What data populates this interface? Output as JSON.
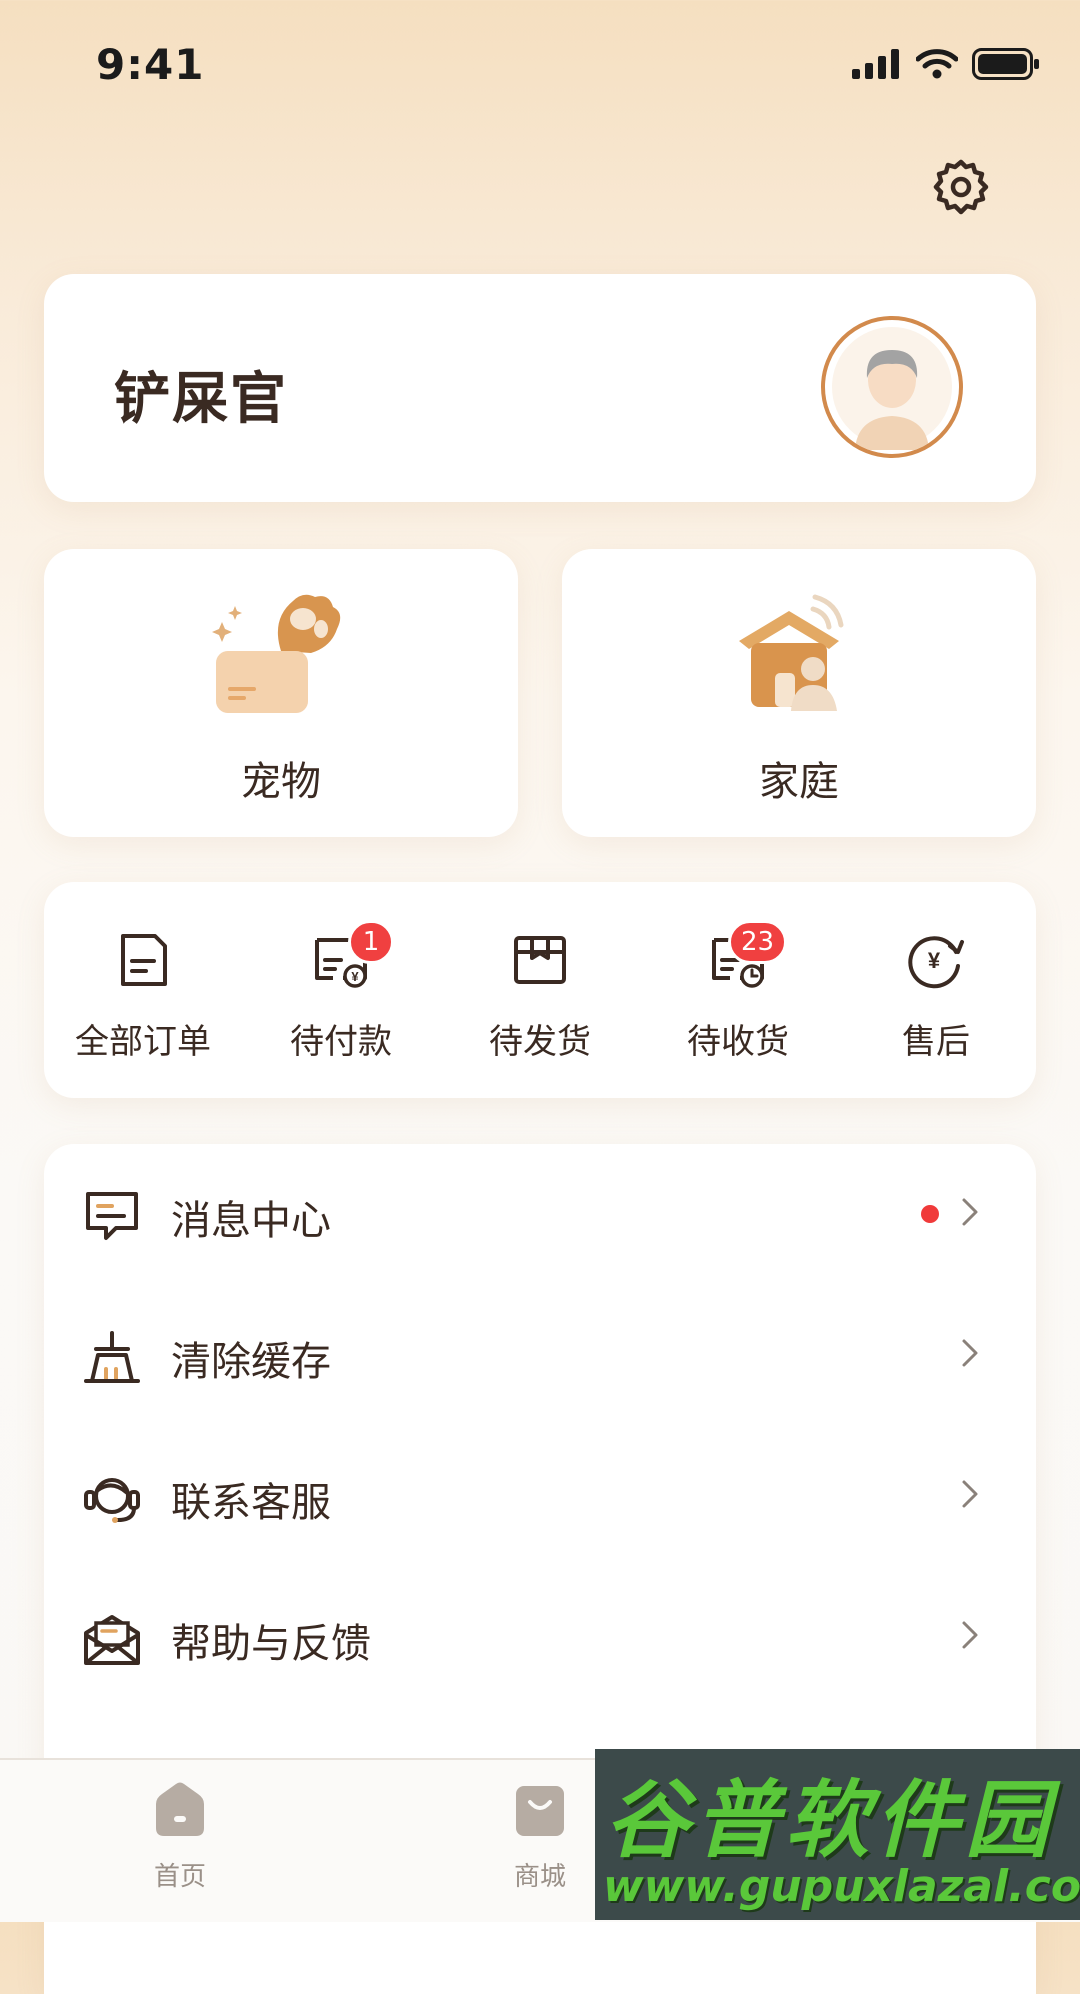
{
  "status_bar": {
    "time": "9:41"
  },
  "profile": {
    "name": "铲屎官"
  },
  "tiles": [
    {
      "label": "宠物",
      "icon": "pet-paw-icon"
    },
    {
      "label": "家庭",
      "icon": "family-house-icon"
    }
  ],
  "orders": [
    {
      "label": "全部订单",
      "icon": "all-orders-icon",
      "badge": ""
    },
    {
      "label": "待付款",
      "icon": "pending-payment-icon",
      "badge": "1"
    },
    {
      "label": "待发货",
      "icon": "pending-shipment-icon",
      "badge": ""
    },
    {
      "label": "待收货",
      "icon": "pending-receipt-icon",
      "badge": "23"
    },
    {
      "label": "售后",
      "icon": "after-sales-icon",
      "badge": ""
    }
  ],
  "menu": [
    {
      "label": "消息中心",
      "icon": "message-icon",
      "has_dot": true
    },
    {
      "label": "清除缓存",
      "icon": "broom-icon",
      "has_dot": false
    },
    {
      "label": "联系客服",
      "icon": "headset-icon",
      "has_dot": false
    },
    {
      "label": "帮助与反馈",
      "icon": "envelope-icon",
      "has_dot": false
    }
  ],
  "tabbar": [
    {
      "label": "首页",
      "icon": "home-icon"
    },
    {
      "label": "商城",
      "icon": "shop-bag-icon"
    }
  ],
  "watermark": {
    "title": "谷普软件园",
    "url": "www.gupuxlazal.com"
  },
  "colors": {
    "accent": "#d28a4c",
    "badge": "#f04040",
    "text": "#3a2a22"
  }
}
